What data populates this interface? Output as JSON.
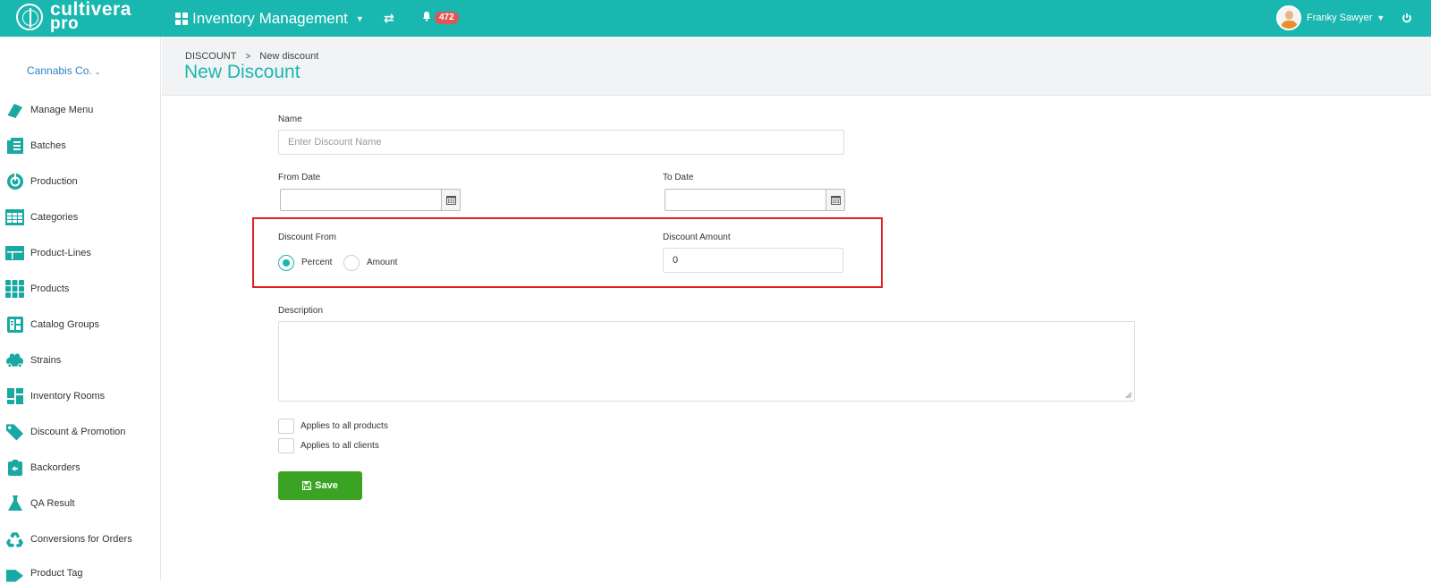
{
  "header": {
    "logo_line1": "cultivera",
    "logo_line2": "pro",
    "app_name": "Inventory Management",
    "notification_count": "472",
    "user_name": "Franky Sawyer"
  },
  "sidebar": {
    "org_name": "Cannabis Co.",
    "items": [
      {
        "label": "Manage Menu",
        "icon": "book-icon"
      },
      {
        "label": "Batches",
        "icon": "batches-icon"
      },
      {
        "label": "Production",
        "icon": "production-icon"
      },
      {
        "label": "Categories",
        "icon": "table-icon"
      },
      {
        "label": "Product-Lines",
        "icon": "product-lines-icon"
      },
      {
        "label": "Products",
        "icon": "products-grid-icon"
      },
      {
        "label": "Catalog Groups",
        "icon": "catalog-icon"
      },
      {
        "label": "Strains",
        "icon": "strains-icon"
      },
      {
        "label": "Inventory Rooms",
        "icon": "rooms-icon"
      },
      {
        "label": "Discount & Promotion",
        "icon": "tags-icon"
      },
      {
        "label": "Backorders",
        "icon": "backorders-icon"
      },
      {
        "label": "QA Result",
        "icon": "flask-icon"
      },
      {
        "label": "Conversions for Orders",
        "icon": "recycle-icon"
      },
      {
        "label": "Product Tag",
        "icon": "tag-icon"
      }
    ]
  },
  "breadcrumb": {
    "root": "DISCOUNT",
    "current": "New discount"
  },
  "page": {
    "title": "New Discount"
  },
  "form": {
    "name_label": "Name",
    "name_placeholder": "Enter Discount Name",
    "name_value": "",
    "from_date_label": "From Date",
    "to_date_label": "To Date",
    "discount_from_label": "Discount From",
    "option_percent": "Percent",
    "option_amount": "Amount",
    "selected_option": "Percent",
    "discount_amount_label": "Discount Amount",
    "discount_amount_value": "0",
    "description_label": "Description",
    "applies_products": "Applies to all products",
    "applies_clients": "Applies to all clients",
    "save_label": "Save"
  },
  "colors": {
    "brand": "#1ab7b0",
    "save": "#3ba323",
    "badge": "#e05555",
    "highlight": "#e02020"
  }
}
